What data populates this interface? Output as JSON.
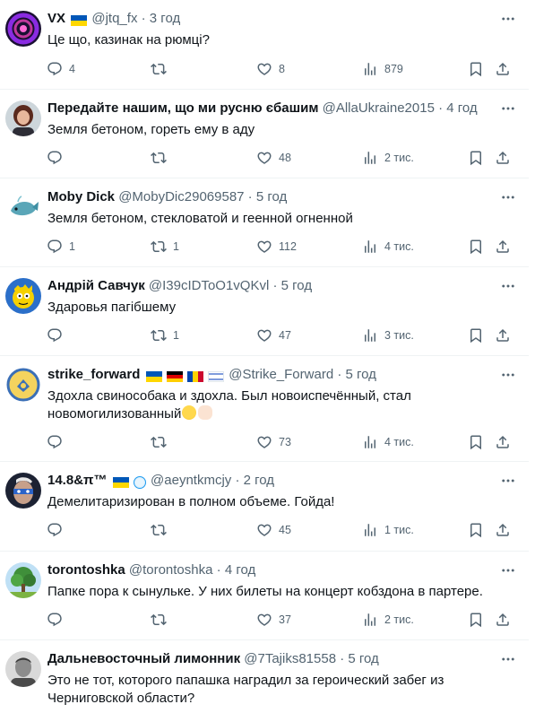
{
  "tweets": [
    {
      "name": "VX",
      "flags": [
        "ua"
      ],
      "handle": "@jtq_fx",
      "time": "3 год",
      "text": "Це що, казинак на рюмці?",
      "replies": "4",
      "retweets": "",
      "likes": "8",
      "views": "879",
      "avatar": "purple-ring-avatar"
    },
    {
      "name": "Передайте нашим, що ми русню єбашим",
      "flags": [],
      "handle": "@AllaUkraine2015",
      "time": "4 год",
      "text": "Земля бетоном, гореть ему в аду",
      "replies": "",
      "retweets": "",
      "likes": "48",
      "views": "2 тис.",
      "avatar": "woman-portrait-avatar"
    },
    {
      "name": "Moby Dick",
      "flags": [],
      "handle": "@MobyDic29069587",
      "time": "5 год",
      "text": "Земля бетоном, стекловатой и геенной огненной",
      "replies": "1",
      "retweets": "1",
      "likes": "112",
      "views": "4 тис.",
      "avatar": "whale-avatar"
    },
    {
      "name": "Андрій Савчук",
      "flags": [],
      "handle": "@I39cIDToO1vQKvl",
      "time": "5 год",
      "text": "Здаровья пагібшему",
      "replies": "",
      "retweets": "1",
      "likes": "47",
      "views": "3 тис.",
      "avatar": "cartoon-avatar"
    },
    {
      "name": "strike_forward",
      "flags": [
        "ua",
        "de",
        "md",
        "il"
      ],
      "handle": "@Strike_Forward",
      "time": "5 год",
      "text": "Здохла свинособака и здохла. Был новоиспечённый, стал",
      "text2": "новомогилизованный",
      "replies": "",
      "retweets": "",
      "likes": "73",
      "views": "4 тис.",
      "avatar": "badge-avatar"
    },
    {
      "name": "14.8&π™",
      "flags": [
        "ua",
        "globe"
      ],
      "handle": "@aeyntkmcjy",
      "time": "2 год",
      "text": "Демелитаризирован в полном объеме. Гойда!",
      "replies": "",
      "retweets": "",
      "likes": "45",
      "views": "1 тис.",
      "avatar": "painted-face-avatar"
    },
    {
      "name": "torontoshka",
      "flags": [],
      "handle": "@torontoshka",
      "time": "4 год",
      "text": "Папке пора к сынульке.  У них билеты на концерт кобздона в партере.",
      "replies": "",
      "retweets": "",
      "likes": "37",
      "views": "2 тис.",
      "avatar": "tree-avatar"
    },
    {
      "name": "Дальневосточный лимонник",
      "flags": [],
      "handle": "@7Tajiks81558",
      "time": "5 год",
      "text": "Это не тот, которого папашка наградил за героический забег из",
      "text2": "Черниговской области?",
      "avatar": "bw-portrait-avatar"
    }
  ],
  "separator": "·",
  "colors": {
    "text": "#0f1419",
    "secondary": "#536471",
    "border": "#eff3f4"
  }
}
